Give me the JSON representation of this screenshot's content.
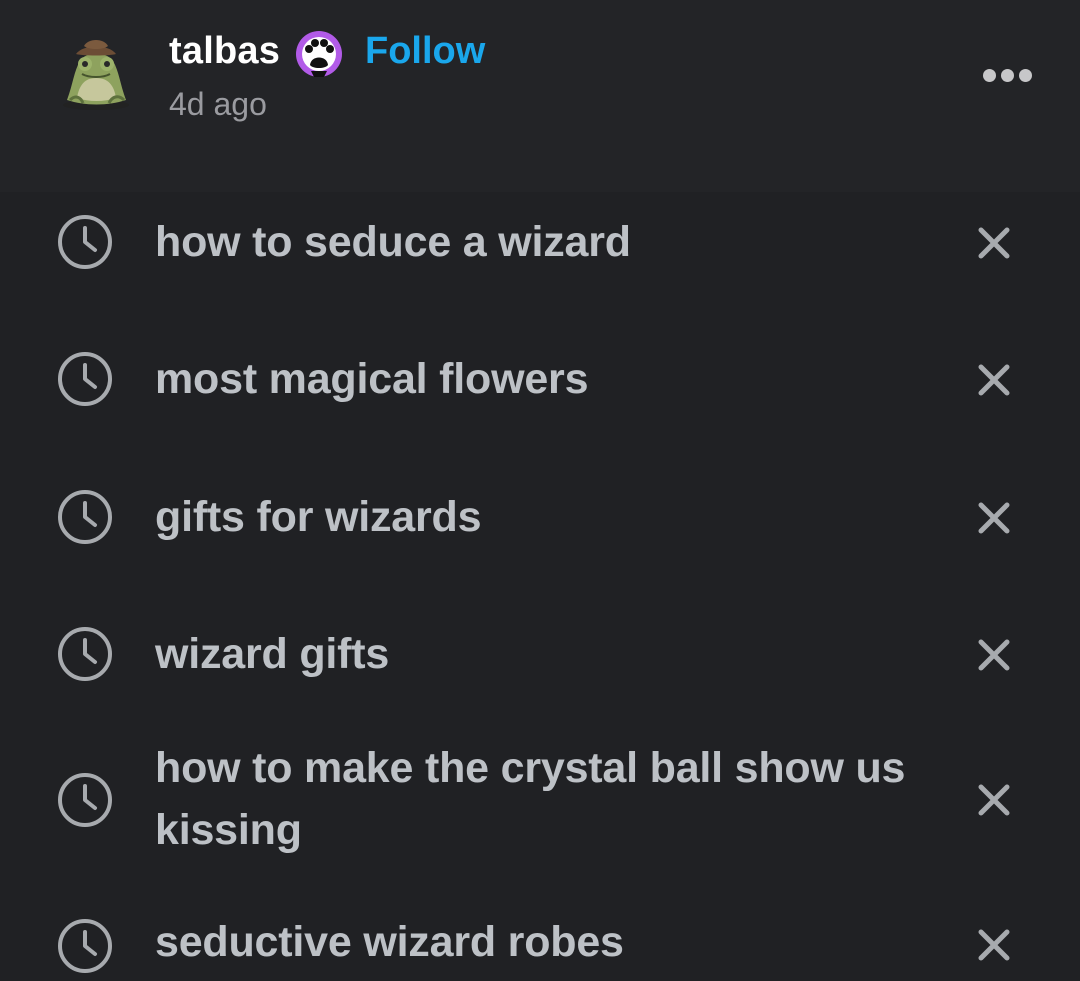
{
  "post": {
    "username": "talbas",
    "follow_label": "Follow",
    "timestamp": "4d ago",
    "avatar_icon": "frog-with-hat-icon",
    "badge_icon": "paw-print-badge-icon",
    "more_icon": "more-options-icon"
  },
  "searches": [
    {
      "query": "how to seduce a wizard",
      "icon": "clock-icon",
      "remove_icon": "close-icon"
    },
    {
      "query": "most magical flowers",
      "icon": "clock-icon",
      "remove_icon": "close-icon"
    },
    {
      "query": "gifts for wizards",
      "icon": "clock-icon",
      "remove_icon": "close-icon"
    },
    {
      "query": "wizard gifts",
      "icon": "clock-icon",
      "remove_icon": "close-icon"
    },
    {
      "query": "how to make the crystal ball show us kissing",
      "icon": "clock-icon",
      "remove_icon": "close-icon"
    },
    {
      "query": "seductive wizard robes",
      "icon": "clock-icon",
      "remove_icon": "close-icon"
    }
  ],
  "colors": {
    "header_background": "#232427",
    "list_background": "#202124",
    "username": "#ffffff",
    "follow": "#1aa7ec",
    "timestamp": "#9a9ba0",
    "query_text": "#bdc1c6",
    "icon": "#a7aaae",
    "badge": "#b25be8"
  }
}
